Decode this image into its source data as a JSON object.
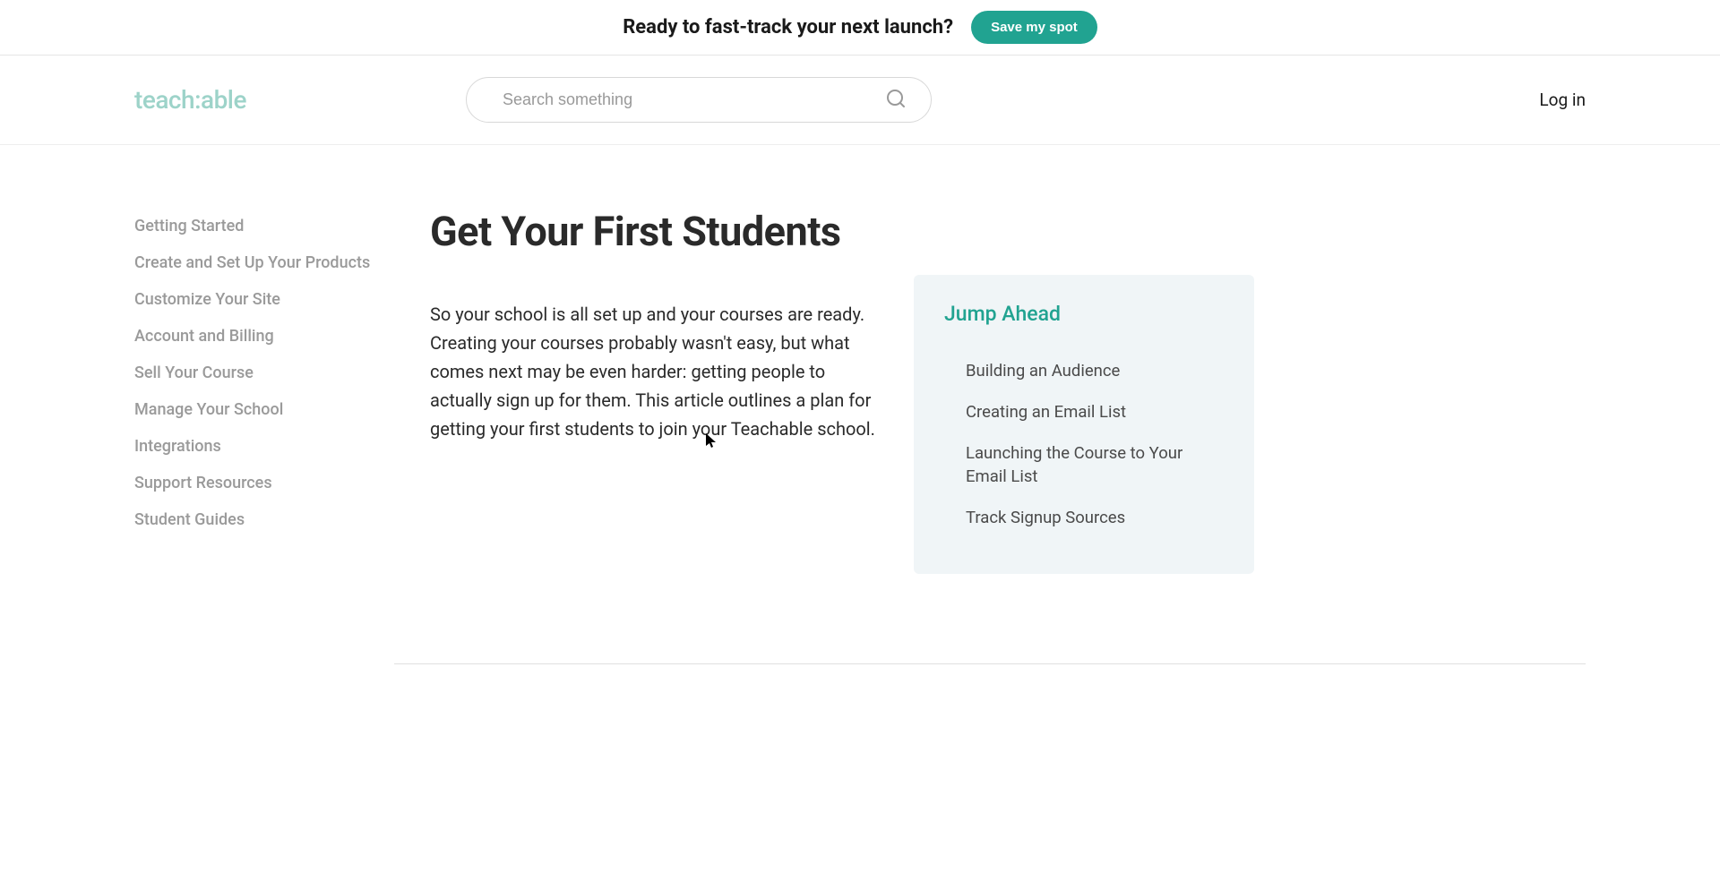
{
  "promo": {
    "text": "Ready to fast-track your next launch?",
    "button_label": "Save my spot"
  },
  "header": {
    "logo_text": "teach:able",
    "search_placeholder": "Search something",
    "login_label": "Log in"
  },
  "sidebar": {
    "items": [
      {
        "label": "Getting Started"
      },
      {
        "label": "Create and Set Up Your Products"
      },
      {
        "label": "Customize Your Site"
      },
      {
        "label": "Account and Billing"
      },
      {
        "label": "Sell Your Course"
      },
      {
        "label": "Manage Your School"
      },
      {
        "label": "Integrations"
      },
      {
        "label": "Support Resources"
      },
      {
        "label": "Student Guides"
      }
    ]
  },
  "article": {
    "title": "Get Your First Students",
    "intro": "So your school is all set up and your courses are ready. Creating your courses probably wasn't easy, but what comes next may be even harder: getting people to actually sign up for them. This article outlines a plan for getting your first students to join your Teachable school."
  },
  "jump": {
    "title": "Jump Ahead",
    "links": [
      {
        "label": "Building an Audience"
      },
      {
        "label": "Creating an Email List"
      },
      {
        "label": "Launching the Course to Your Email List"
      },
      {
        "label": "Track Signup Sources"
      }
    ]
  }
}
